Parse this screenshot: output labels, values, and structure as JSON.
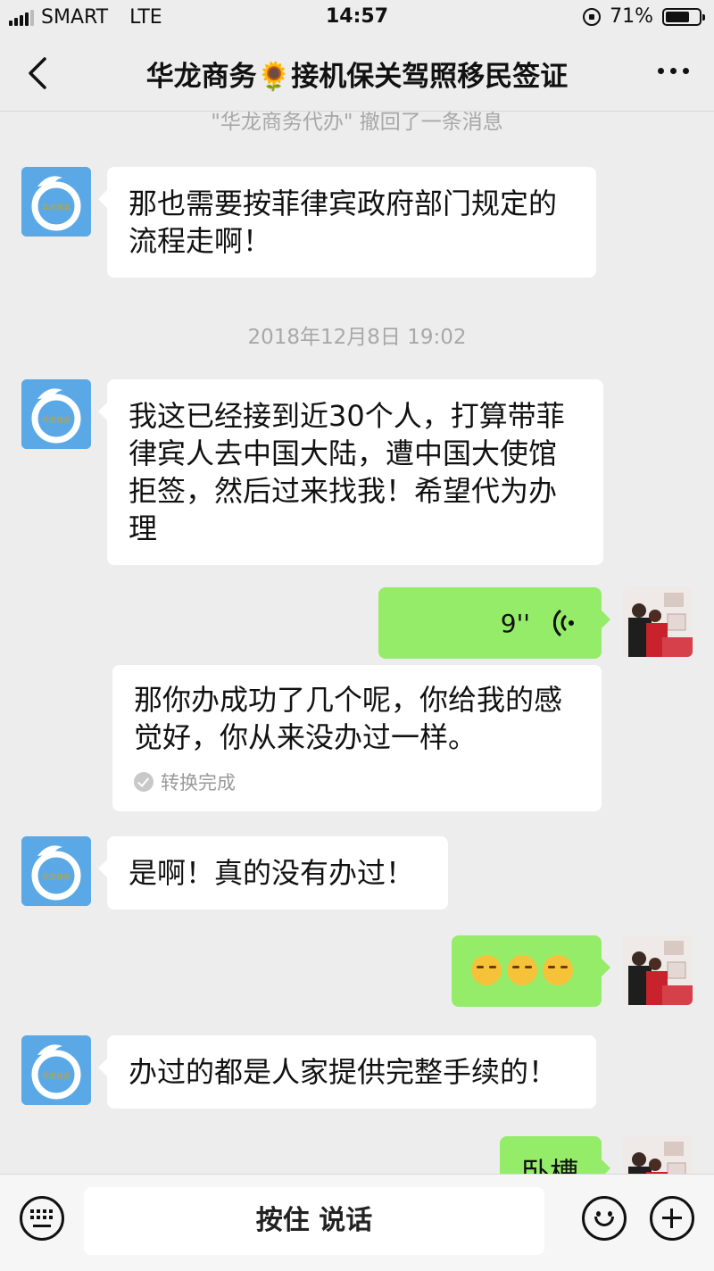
{
  "status_bar": {
    "carrier": "SMART",
    "network": "LTE",
    "time": "14:57",
    "battery": "71%",
    "battery_level": 0.71
  },
  "header": {
    "title": "华龙商务🌻接机保关驾照移民签证"
  },
  "chat": {
    "recall_notice": "\"华龙商务代办\" 撤回了一条消息",
    "timestamp": "2018年12月8日 19:02",
    "messages": [
      {
        "side": "left",
        "type": "text",
        "text": "那也需要按菲律宾政府部门规定的流程走啊！"
      },
      {
        "side": "left",
        "type": "text",
        "text": "我这已经接到近30个人，打算带菲律宾人去中国大陆，遭中国大使馆拒签，然后过来找我！希望代为办理"
      },
      {
        "side": "right",
        "type": "voice",
        "duration": "9''",
        "transcript": "那你办成功了几个呢，你给我的感觉好，你从来没办过一样。",
        "transcript_status": "转换完成"
      },
      {
        "side": "left",
        "type": "text",
        "text": "是啊！真的没有办过！"
      },
      {
        "side": "right",
        "type": "emoji",
        "count": 3
      },
      {
        "side": "left",
        "type": "text",
        "text": "办过的都是人家提供完整手续的！"
      },
      {
        "side": "right",
        "type": "text",
        "text": "卧槽"
      }
    ],
    "avatar_left_text": "华龙商务"
  },
  "input_bar": {
    "hold_to_talk": "按住 说话"
  }
}
